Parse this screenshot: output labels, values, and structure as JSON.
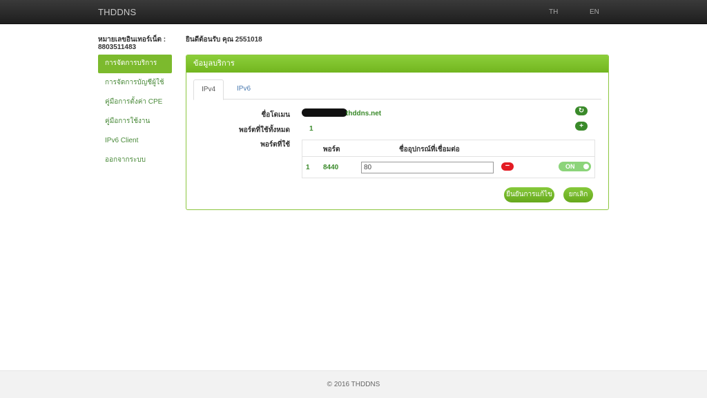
{
  "navbar": {
    "brand": "THDDNS",
    "lang_th": "TH",
    "lang_en": "EN"
  },
  "account": {
    "label": "หมายเลขอินเทอร์เน็ต :",
    "number": "8803511483",
    "welcome": "ยินดีต้อนรับ คุณ 2551018"
  },
  "sidebar": {
    "items": [
      {
        "label": "การจัดการบริการ",
        "active": true
      },
      {
        "label": "การจัดการบัญชีผู้ใช้",
        "active": false
      },
      {
        "label": "คู่มือการตั้งค่า CPE",
        "active": false
      },
      {
        "label": "คู่มือการใช้งาน",
        "active": false
      },
      {
        "label": "IPv6 Client",
        "active": false
      },
      {
        "label": "ออกจากระบบ",
        "active": false
      }
    ]
  },
  "panel": {
    "title": "ข้อมูลบริการ",
    "tabs": [
      {
        "label": "IPv4",
        "active": true
      },
      {
        "label": "IPv6",
        "active": false
      }
    ],
    "domain_label": "ชื่อโดเมน",
    "domain_value": "thddns.net",
    "total_ports_label": "พอร์ตที่ใช้ทั้งหมด",
    "total_ports_value": "1",
    "used_ports_label": "พอร์ตที่ใช้",
    "refresh_icon": "refresh-icon",
    "add_icon": "plus-icon",
    "table": {
      "headers": [
        "พอร์ต",
        "ชื่ออุปกรณ์ที่เชื่อมต่อ"
      ],
      "rows": [
        {
          "index": "1",
          "port": "8440",
          "device": "80",
          "toggle": "ON"
        }
      ]
    },
    "confirm_label": "ยืนยันการแก้ไข",
    "cancel_label": "ยกเลิก"
  },
  "footer": {
    "text": "© 2016 THDDNS"
  },
  "colors": {
    "accent": "#7cba2d",
    "dark_green": "#3a8a2a",
    "danger": "#e31b23",
    "navbar": "#2a2a2a"
  }
}
